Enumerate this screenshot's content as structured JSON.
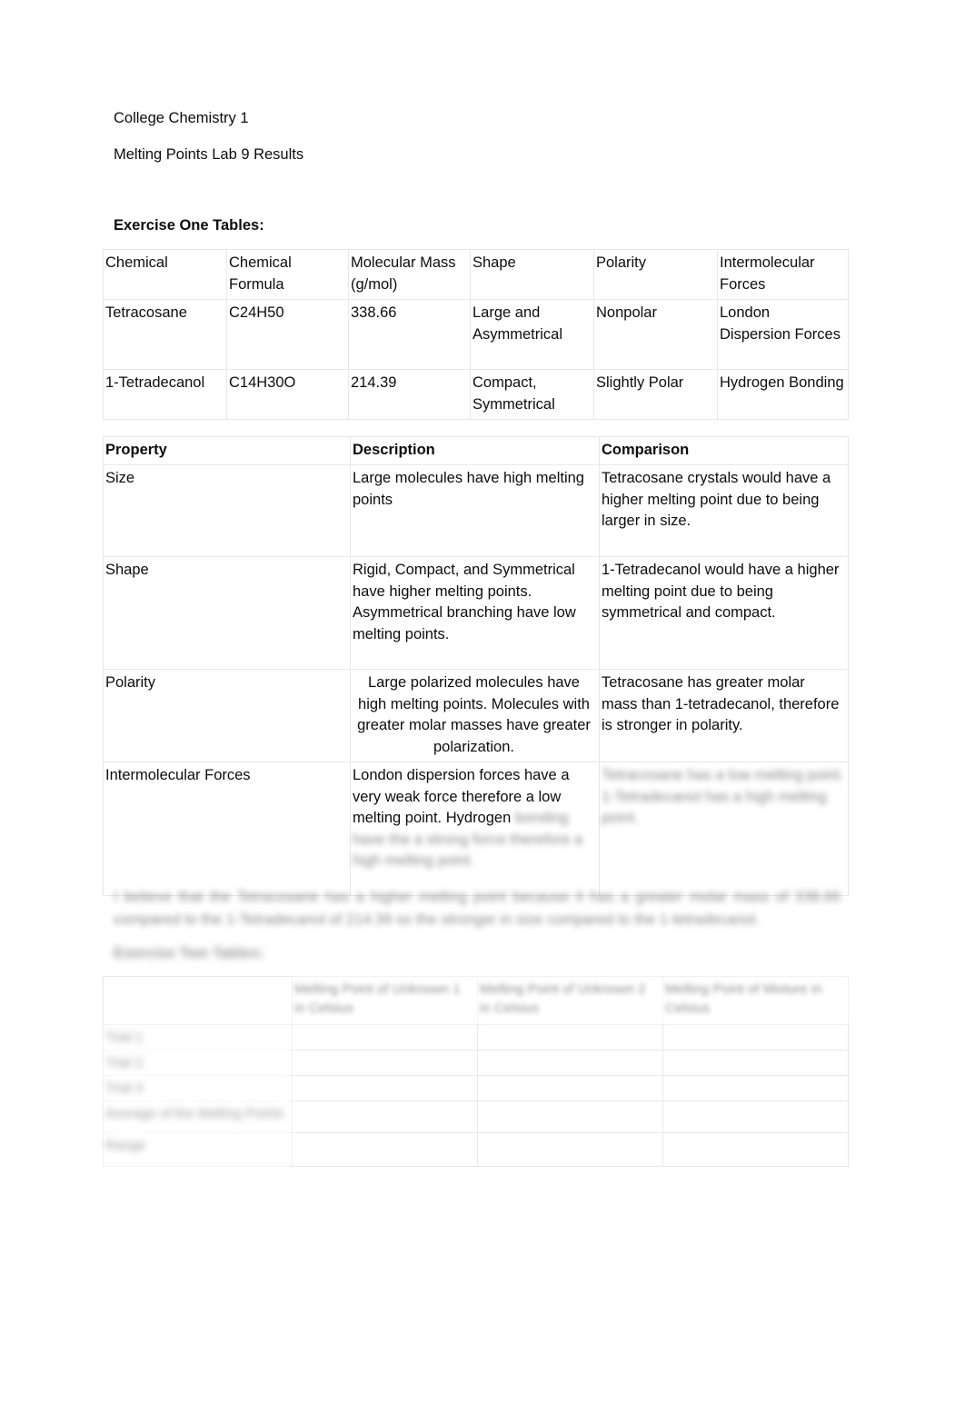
{
  "document": {
    "course": "College Chemistry 1",
    "lab_title": "Melting Points Lab 9 Results",
    "section_heading": "Exercise One Tables:"
  },
  "table_one": {
    "name": "chemical-properties-table",
    "headers": [
      "Chemical",
      "Chemical Formula",
      "Molecular Mass (g/mol)",
      "Shape",
      "Polarity",
      "Intermolecular Forces"
    ],
    "rows": [
      {
        "chemical": "Tetracosane",
        "formula": "C24H50",
        "molecular_mass": "338.66",
        "shape": "Large and Asymmetrical",
        "polarity": "Nonpolar",
        "intermolecular_forces": "London Dispersion Forces"
      },
      {
        "chemical": "1-Tetradecanol",
        "formula": "C14H30O",
        "molecular_mass": "214.39",
        "shape": "Compact, Symmetrical",
        "polarity": "Slightly Polar",
        "intermolecular_forces": "Hydrogen Bonding"
      }
    ]
  },
  "table_two": {
    "name": "property-description-comparison-table",
    "headers": [
      "Property",
      "Description",
      "Comparison"
    ],
    "rows": [
      {
        "property": "Size",
        "description": "Large molecules have high melting points",
        "comparison": "Tetracosane crystals would have a higher melting point due to being larger in size."
      },
      {
        "property": "Shape",
        "description": "Rigid, Compact, and Symmetrical have higher melting points. Asymmetrical branching have low melting points.",
        "comparison": "1-Tetradecanol would have a higher melting point due to being symmetrical and compact."
      },
      {
        "property": "Polarity",
        "description": "Large polarized molecules have high melting points. Molecules with greater molar masses have greater polarization.",
        "comparison": "Tetracosane has greater molar mass than 1-tetradecanol, therefore is stronger in polarity."
      },
      {
        "property": "Intermolecular Forces",
        "description": "London dispersion forces have a very weak force therefore a low melting point. Hydrogen",
        "description_obscured": "bonding have the a strong force therefore a high melting point.",
        "comparison_obscured": "Tetracosane has a low melting point. 1-Tetradecanol has a high melting point."
      }
    ]
  },
  "paragraph_obscured": {
    "name": "conclusion-paragraph",
    "text": "I believe that the Tetracosane has a higher melting point because it has a greater molar mass of 338.66 compared to the 1-Tetradecanol of 214.39 so the stronger in size compared to the 1-tetradecanol."
  },
  "heading_two_obscured": {
    "name": "exercise-two-heading",
    "text": "Exercise Two Tables:"
  },
  "table_three": {
    "name": "melting-point-results-table",
    "headers_obscured": [
      "",
      "Melting Point of Unknown 1 in Celsius",
      "Melting Point of Unknown 2 in Celsius",
      "Melting Point of Mixture in Celsius"
    ],
    "rows_obscured": [
      [
        "Trial 1",
        "",
        "",
        ""
      ],
      [
        "Trial 2",
        "",
        "",
        ""
      ],
      [
        "Trial 3",
        "",
        "",
        ""
      ],
      [
        "Average of the Melting Points",
        "",
        "",
        ""
      ],
      [
        "Range",
        "",
        "",
        ""
      ]
    ]
  }
}
